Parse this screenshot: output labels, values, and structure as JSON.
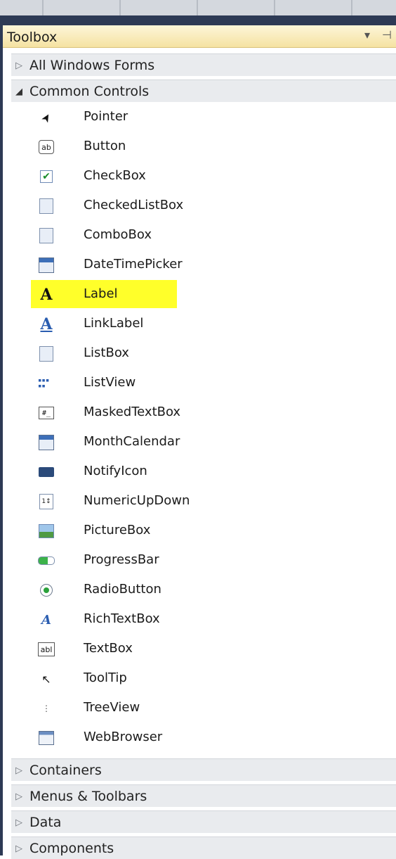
{
  "toolbox": {
    "title": "Toolbox",
    "header_icons": "▾ ⊣",
    "groups_before": [
      {
        "label": "All Windows Forms",
        "arrow": "▷"
      }
    ],
    "expanded_group": {
      "label": "Common Controls",
      "arrow": "◢"
    },
    "items": [
      {
        "label": "Pointer",
        "icon": "pointer-icon"
      },
      {
        "label": "Button",
        "icon": "button-icon"
      },
      {
        "label": "CheckBox",
        "icon": "checkbox-icon"
      },
      {
        "label": "CheckedListBox",
        "icon": "checkedlistbox-icon"
      },
      {
        "label": "ComboBox",
        "icon": "combobox-icon"
      },
      {
        "label": "DateTimePicker",
        "icon": "datetimepicker-icon"
      },
      {
        "label": "Label",
        "icon": "label-icon",
        "highlighted": true
      },
      {
        "label": "LinkLabel",
        "icon": "linklabel-icon"
      },
      {
        "label": "ListBox",
        "icon": "listbox-icon"
      },
      {
        "label": "ListView",
        "icon": "listview-icon"
      },
      {
        "label": "MaskedTextBox",
        "icon": "maskedtextbox-icon"
      },
      {
        "label": "MonthCalendar",
        "icon": "monthcalendar-icon"
      },
      {
        "label": "NotifyIcon",
        "icon": "notifyicon-icon"
      },
      {
        "label": "NumericUpDown",
        "icon": "numericupdown-icon"
      },
      {
        "label": "PictureBox",
        "icon": "picturebox-icon"
      },
      {
        "label": "ProgressBar",
        "icon": "progressbar-icon"
      },
      {
        "label": "RadioButton",
        "icon": "radiobutton-icon"
      },
      {
        "label": "RichTextBox",
        "icon": "richtextbox-icon"
      },
      {
        "label": "TextBox",
        "icon": "textbox-icon"
      },
      {
        "label": "ToolTip",
        "icon": "tooltip-icon"
      },
      {
        "label": "TreeView",
        "icon": "treeview-icon"
      },
      {
        "label": "WebBrowser",
        "icon": "webbrowser-icon"
      }
    ],
    "groups_after": [
      {
        "label": "Containers",
        "arrow": "▷"
      },
      {
        "label": "Menus & Toolbars",
        "arrow": "▷"
      },
      {
        "label": "Data",
        "arrow": "▷"
      },
      {
        "label": "Components",
        "arrow": "▷"
      }
    ],
    "highlight_color": "#ffff2a"
  }
}
